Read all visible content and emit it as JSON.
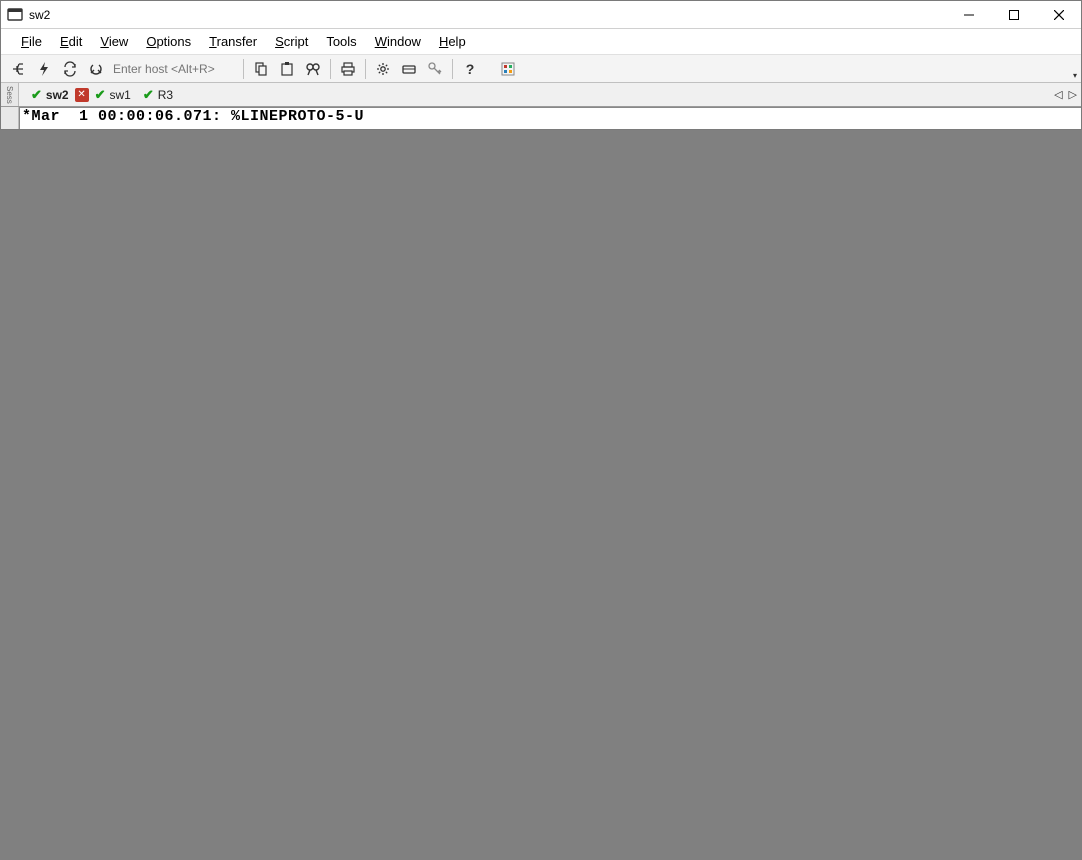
{
  "window": {
    "title": "sw2"
  },
  "menu": {
    "file": "File",
    "edit": "Edit",
    "view": "View",
    "options": "Options",
    "transfer": "Transfer",
    "script": "Script",
    "tools": "Tools",
    "window": "Window",
    "help": "Help"
  },
  "toolbar": {
    "host_placeholder": "Enter host <Alt+R>"
  },
  "sessions": {
    "handle_label": "Sess"
  },
  "tabs": [
    {
      "name": "sw2",
      "status": "connected",
      "active": true,
      "closable": true
    },
    {
      "name": "sw1",
      "status": "connected",
      "active": false,
      "closable": false
    },
    {
      "name": "R3",
      "status": "connected",
      "active": false,
      "closable": false
    }
  ],
  "terminal": {
    "line0": "*Mar  1 00:00:06.071: %LINEPROTO-5-U"
  }
}
